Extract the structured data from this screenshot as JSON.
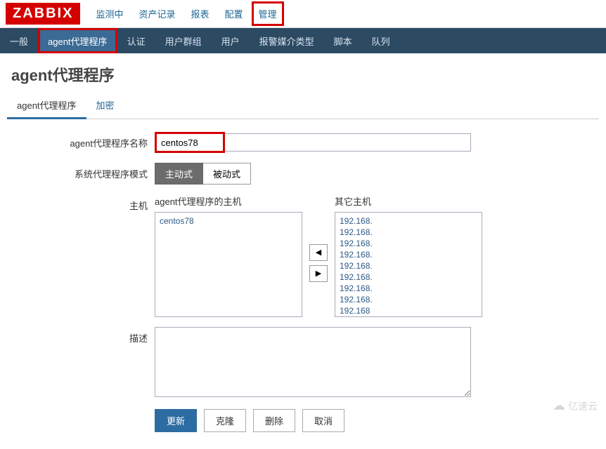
{
  "logo": "ZABBIX",
  "topNav": {
    "items": [
      {
        "label": "监测中"
      },
      {
        "label": "资产记录"
      },
      {
        "label": "报表"
      },
      {
        "label": "配置"
      },
      {
        "label": "管理",
        "active": true
      }
    ]
  },
  "subNav": {
    "items": [
      {
        "label": "一般"
      },
      {
        "label": "agent代理程序",
        "active": true
      },
      {
        "label": "认证"
      },
      {
        "label": "用户群组"
      },
      {
        "label": "用户"
      },
      {
        "label": "报警媒介类型"
      },
      {
        "label": "脚本"
      },
      {
        "label": "队列"
      }
    ]
  },
  "pageTitle": "agent代理程序",
  "tabs": [
    {
      "label": "agent代理程序",
      "active": true
    },
    {
      "label": "加密"
    }
  ],
  "form": {
    "nameLabel": "agent代理程序名称",
    "nameValue": "centos78",
    "modeLabel": "系统代理程序模式",
    "modeActive": "主动式",
    "modePassive": "被动式",
    "hostsLabel": "主机",
    "agentHostsLabel": "agent代理程序的主机",
    "agentHosts": [
      "centos78"
    ],
    "otherHostsLabel": "其它主机",
    "otherHosts": [
      "192.168.",
      "192.168.",
      "192.168.",
      "192.168.",
      "192.168.",
      "192.168.",
      "192.168.",
      "192.168.",
      "192.168"
    ],
    "descLabel": "描述",
    "descValue": ""
  },
  "actions": {
    "update": "更新",
    "clone": "克隆",
    "delete": "删除",
    "cancel": "取消"
  },
  "watermark": "亿速云"
}
